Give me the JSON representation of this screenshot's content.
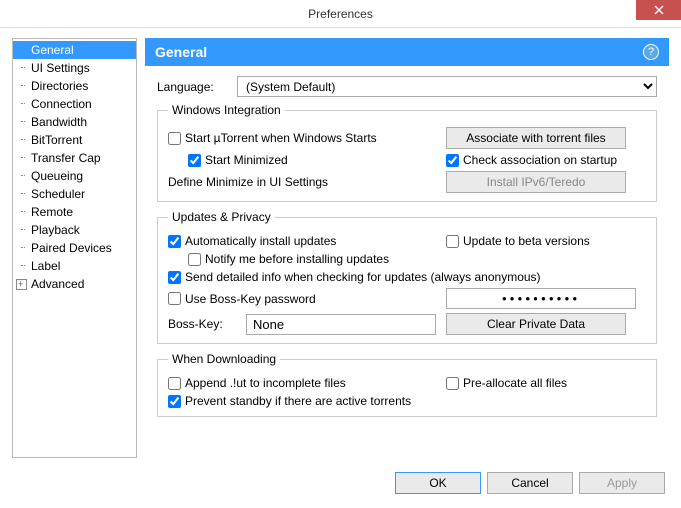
{
  "window": {
    "title": "Preferences"
  },
  "sidebar": {
    "items": [
      {
        "label": "General"
      },
      {
        "label": "UI Settings"
      },
      {
        "label": "Directories"
      },
      {
        "label": "Connection"
      },
      {
        "label": "Bandwidth"
      },
      {
        "label": "BitTorrent"
      },
      {
        "label": "Transfer Cap"
      },
      {
        "label": "Queueing"
      },
      {
        "label": "Scheduler"
      },
      {
        "label": "Remote"
      },
      {
        "label": "Playback"
      },
      {
        "label": "Paired Devices"
      },
      {
        "label": "Label"
      },
      {
        "label": "Advanced"
      }
    ]
  },
  "panel": {
    "title": "General"
  },
  "language": {
    "label": "Language:",
    "value": "(System Default)"
  },
  "windows_integration": {
    "legend": "Windows Integration",
    "start_with_windows": "Start µTorrent when Windows Starts",
    "start_minimized": "Start Minimized",
    "define_minimize": "Define Minimize in UI Settings",
    "associate_btn": "Associate with torrent files",
    "check_association": "Check association on startup",
    "install_ipv6": "Install IPv6/Teredo"
  },
  "updates": {
    "legend": "Updates & Privacy",
    "auto_install": "Automatically install updates",
    "update_beta": "Update to beta versions",
    "notify": "Notify me before installing updates",
    "send_detailed": "Send detailed info when checking for updates (always anonymous)",
    "boss_key_pw": "Use Boss-Key password",
    "password_value": "●●●●●●●●●●",
    "boss_key_label": "Boss-Key:",
    "boss_key_value": "None",
    "clear_btn": "Clear Private Data"
  },
  "downloading": {
    "legend": "When Downloading",
    "append_ut": "Append .!ut to incomplete files",
    "pre_allocate": "Pre-allocate all files",
    "prevent_standby": "Prevent standby if there are active torrents"
  },
  "footer": {
    "ok": "OK",
    "cancel": "Cancel",
    "apply": "Apply"
  }
}
